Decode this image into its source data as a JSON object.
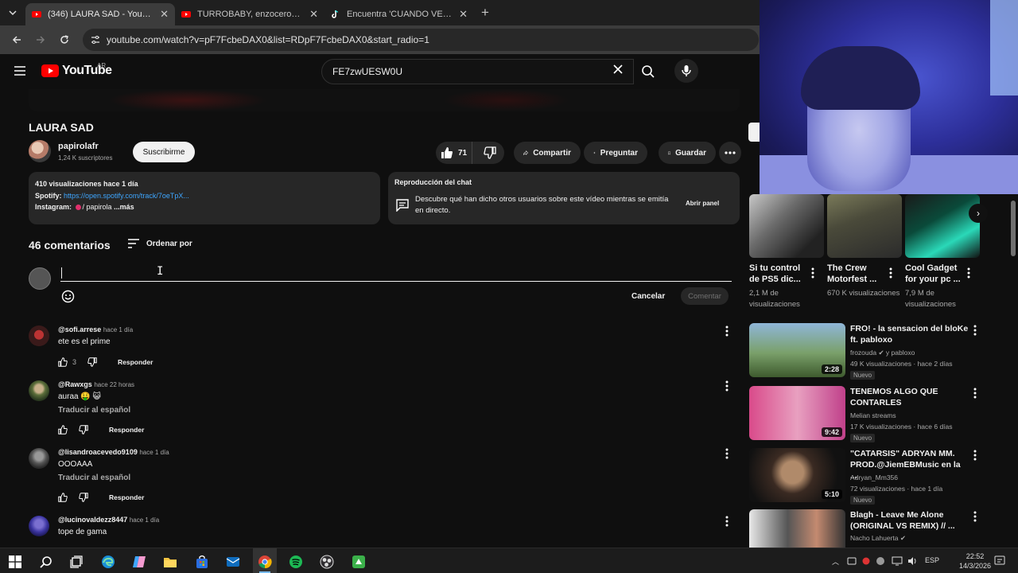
{
  "browser": {
    "tabs": [
      {
        "title": "(346) LAURA SAD - YouTube",
        "active": true
      },
      {
        "title": "TURROBABY, enzocerobulto - L",
        "active": false
      },
      {
        "title": "Encuentra 'CUANDO VEA A BA",
        "active": false
      }
    ],
    "url": "youtube.com/watch?v=pF7FcbeDAX0&list=RDpF7FcbeDAX0&start_radio=1"
  },
  "youtube": {
    "logo_text": "YouTube",
    "country": "AR",
    "search_value": "FE7zwUESW0U"
  },
  "video": {
    "title": "LAURA SAD",
    "channel": "papirolafr",
    "subscribers": "1,24 K suscriptores",
    "subscribe_label": "Suscribirme",
    "likes": "71",
    "share_label": "Compartir",
    "ask_label": "Preguntar",
    "save_label": "Guardar",
    "description": {
      "stats": "410 visualizaciones  hace 1 día",
      "spotify_label": "Spotify:",
      "spotify_link": "https://open.spotify.com/track/7oeTpX...",
      "instagram_label": "Instagram:",
      "instagram_handle": "/ papirola",
      "more_label": "...más"
    },
    "chat_replay": {
      "title": "Reproducción del chat",
      "text": "Descubre qué han dicho otros usuarios sobre este vídeo mientras se emitía en directo.",
      "open_label": "Abrir panel"
    }
  },
  "comments": {
    "count_label": "46 comentarios",
    "sort_label": "Ordenar por",
    "cancel_label": "Cancelar",
    "submit_label": "Comentar",
    "reply_label": "Responder",
    "translate_label": "Traducir al español",
    "items": [
      {
        "handle": "@sofi.arrese",
        "time": "hace 1 día",
        "text": "ete es el prime",
        "likes": "3",
        "translate": false
      },
      {
        "handle": "@Rawxgs",
        "time": "hace 22 horas",
        "text": "auraa 🤑 😺",
        "likes": "",
        "translate": true
      },
      {
        "handle": "@lisandroacevedo9109",
        "time": "hace 1 día",
        "text": "OOOAAA",
        "likes": "",
        "translate": true
      },
      {
        "handle": "@lucinovaldezz8447",
        "time": "hace 1 día",
        "text": "tope de gama",
        "likes": "",
        "translate": false
      }
    ]
  },
  "shorts": [
    {
      "title": "Si tu control de PS5 dic...",
      "views": "2,1 M de visualizaciones"
    },
    {
      "title": "The Crew Motorfest ...",
      "views": "670 K visualizaciones"
    },
    {
      "title": "Cool Gadget for your pc ...",
      "views": "7,9 M de visualizaciones"
    }
  ],
  "recommended": [
    {
      "title": "FRO! - la sensacion del bloKe ft. pabloxo",
      "channel": "frozouda ✔ y pabloxo",
      "views": "49 K visualizaciones · hace 2 días",
      "badge": "Nuevo",
      "duration": "2:28"
    },
    {
      "title": "TENEMOS ALGO QUE CONTARLES",
      "channel": "Melian streams",
      "views": "17 K visualizaciones · hace 6 días",
      "badge": "Nuevo",
      "duration": "9:42"
    },
    {
      "title": "\"CATARSIS\" ADRYAN MM. PROD.@JiemEBMusic en la ...",
      "channel": "Adryan_Mm356",
      "views": "72 visualizaciones · hace 1 día",
      "badge": "Nuevo",
      "duration": "5:10"
    },
    {
      "title": "Blagh - Leave Me Alone (ORIGINAL VS REMIX) // ...",
      "channel": "Nacho Lahuerta ✔",
      "views": "",
      "badge": "",
      "duration": ""
    }
  ],
  "taskbar": {
    "language": "ESP",
    "time": "22:52",
    "date": "14/3/2026"
  }
}
